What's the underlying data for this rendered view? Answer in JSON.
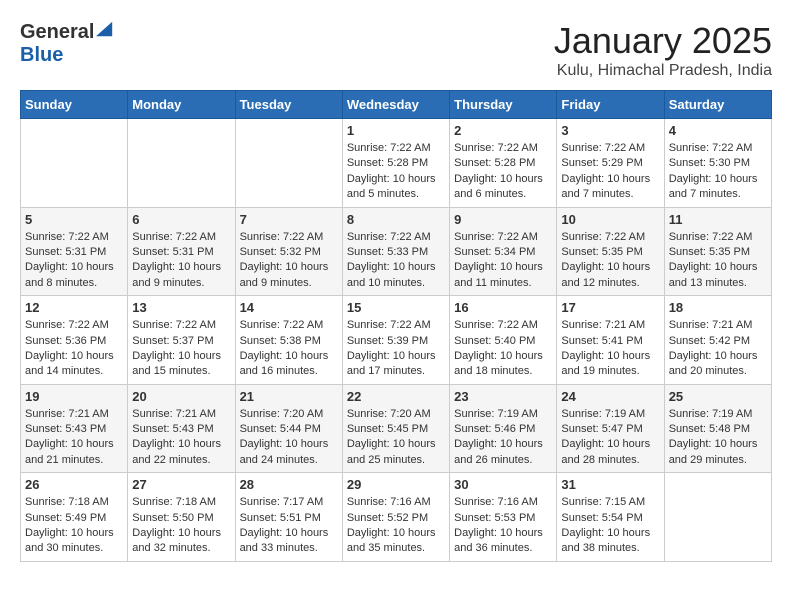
{
  "header": {
    "logo_general": "General",
    "logo_blue": "Blue",
    "month_title": "January 2025",
    "location": "Kulu, Himachal Pradesh, India"
  },
  "weekdays": [
    "Sunday",
    "Monday",
    "Tuesday",
    "Wednesday",
    "Thursday",
    "Friday",
    "Saturday"
  ],
  "weeks": [
    [
      {
        "day": "",
        "info": ""
      },
      {
        "day": "",
        "info": ""
      },
      {
        "day": "",
        "info": ""
      },
      {
        "day": "1",
        "info": "Sunrise: 7:22 AM\nSunset: 5:28 PM\nDaylight: 10 hours\nand 5 minutes."
      },
      {
        "day": "2",
        "info": "Sunrise: 7:22 AM\nSunset: 5:28 PM\nDaylight: 10 hours\nand 6 minutes."
      },
      {
        "day": "3",
        "info": "Sunrise: 7:22 AM\nSunset: 5:29 PM\nDaylight: 10 hours\nand 7 minutes."
      },
      {
        "day": "4",
        "info": "Sunrise: 7:22 AM\nSunset: 5:30 PM\nDaylight: 10 hours\nand 7 minutes."
      }
    ],
    [
      {
        "day": "5",
        "info": "Sunrise: 7:22 AM\nSunset: 5:31 PM\nDaylight: 10 hours\nand 8 minutes."
      },
      {
        "day": "6",
        "info": "Sunrise: 7:22 AM\nSunset: 5:31 PM\nDaylight: 10 hours\nand 9 minutes."
      },
      {
        "day": "7",
        "info": "Sunrise: 7:22 AM\nSunset: 5:32 PM\nDaylight: 10 hours\nand 9 minutes."
      },
      {
        "day": "8",
        "info": "Sunrise: 7:22 AM\nSunset: 5:33 PM\nDaylight: 10 hours\nand 10 minutes."
      },
      {
        "day": "9",
        "info": "Sunrise: 7:22 AM\nSunset: 5:34 PM\nDaylight: 10 hours\nand 11 minutes."
      },
      {
        "day": "10",
        "info": "Sunrise: 7:22 AM\nSunset: 5:35 PM\nDaylight: 10 hours\nand 12 minutes."
      },
      {
        "day": "11",
        "info": "Sunrise: 7:22 AM\nSunset: 5:35 PM\nDaylight: 10 hours\nand 13 minutes."
      }
    ],
    [
      {
        "day": "12",
        "info": "Sunrise: 7:22 AM\nSunset: 5:36 PM\nDaylight: 10 hours\nand 14 minutes."
      },
      {
        "day": "13",
        "info": "Sunrise: 7:22 AM\nSunset: 5:37 PM\nDaylight: 10 hours\nand 15 minutes."
      },
      {
        "day": "14",
        "info": "Sunrise: 7:22 AM\nSunset: 5:38 PM\nDaylight: 10 hours\nand 16 minutes."
      },
      {
        "day": "15",
        "info": "Sunrise: 7:22 AM\nSunset: 5:39 PM\nDaylight: 10 hours\nand 17 minutes."
      },
      {
        "day": "16",
        "info": "Sunrise: 7:22 AM\nSunset: 5:40 PM\nDaylight: 10 hours\nand 18 minutes."
      },
      {
        "day": "17",
        "info": "Sunrise: 7:21 AM\nSunset: 5:41 PM\nDaylight: 10 hours\nand 19 minutes."
      },
      {
        "day": "18",
        "info": "Sunrise: 7:21 AM\nSunset: 5:42 PM\nDaylight: 10 hours\nand 20 minutes."
      }
    ],
    [
      {
        "day": "19",
        "info": "Sunrise: 7:21 AM\nSunset: 5:43 PM\nDaylight: 10 hours\nand 21 minutes."
      },
      {
        "day": "20",
        "info": "Sunrise: 7:21 AM\nSunset: 5:43 PM\nDaylight: 10 hours\nand 22 minutes."
      },
      {
        "day": "21",
        "info": "Sunrise: 7:20 AM\nSunset: 5:44 PM\nDaylight: 10 hours\nand 24 minutes."
      },
      {
        "day": "22",
        "info": "Sunrise: 7:20 AM\nSunset: 5:45 PM\nDaylight: 10 hours\nand 25 minutes."
      },
      {
        "day": "23",
        "info": "Sunrise: 7:19 AM\nSunset: 5:46 PM\nDaylight: 10 hours\nand 26 minutes."
      },
      {
        "day": "24",
        "info": "Sunrise: 7:19 AM\nSunset: 5:47 PM\nDaylight: 10 hours\nand 28 minutes."
      },
      {
        "day": "25",
        "info": "Sunrise: 7:19 AM\nSunset: 5:48 PM\nDaylight: 10 hours\nand 29 minutes."
      }
    ],
    [
      {
        "day": "26",
        "info": "Sunrise: 7:18 AM\nSunset: 5:49 PM\nDaylight: 10 hours\nand 30 minutes."
      },
      {
        "day": "27",
        "info": "Sunrise: 7:18 AM\nSunset: 5:50 PM\nDaylight: 10 hours\nand 32 minutes."
      },
      {
        "day": "28",
        "info": "Sunrise: 7:17 AM\nSunset: 5:51 PM\nDaylight: 10 hours\nand 33 minutes."
      },
      {
        "day": "29",
        "info": "Sunrise: 7:16 AM\nSunset: 5:52 PM\nDaylight: 10 hours\nand 35 minutes."
      },
      {
        "day": "30",
        "info": "Sunrise: 7:16 AM\nSunset: 5:53 PM\nDaylight: 10 hours\nand 36 minutes."
      },
      {
        "day": "31",
        "info": "Sunrise: 7:15 AM\nSunset: 5:54 PM\nDaylight: 10 hours\nand 38 minutes."
      },
      {
        "day": "",
        "info": ""
      }
    ]
  ]
}
